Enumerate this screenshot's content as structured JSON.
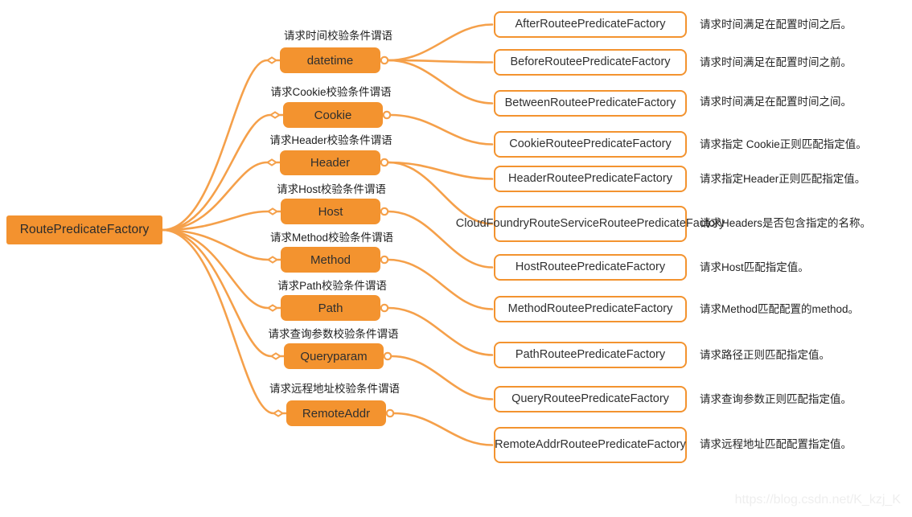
{
  "diagram": {
    "title": "RoutePredicateFactory",
    "colors": {
      "node_fill": "#f3932f",
      "edge": "#f5a04a",
      "leaf_border": "#f3932f",
      "leaf_fill": "#ffffff",
      "text": "#2b2b2b",
      "watermark": "#eeeeee"
    }
  },
  "root": {
    "label": "RoutePredicateFactory"
  },
  "branches": [
    {
      "id": "datetime",
      "name": "datetime",
      "caption": "请求时间校验条件谓语",
      "leaves": [
        {
          "name": "AfterRouteePredicateFactory",
          "desc": "请求时间满足在配置时间之后。"
        },
        {
          "name": "BeforeRouteePredicateFactory",
          "desc": "请求时间满足在配置时间之前。"
        },
        {
          "name": "BetweenRouteePredicateFactory",
          "desc": "请求时间满足在配置时间之间。"
        }
      ]
    },
    {
      "id": "cookie",
      "name": "Cookie",
      "caption": "请求Cookie校验条件谓语",
      "leaves": [
        {
          "name": "CookieRouteePredicateFactory",
          "desc": "请求指定 Cookie正则匹配指定值。"
        }
      ]
    },
    {
      "id": "header",
      "name": "Header",
      "caption": "请求Header校验条件谓语",
      "leaves": [
        {
          "name": "HeaderRouteePredicateFactory",
          "desc": "请求指定Header正则匹配指定值。"
        },
        {
          "name": "CloudFoundryRouteServiceRouteePredicateFactory",
          "desc": "请求Headers是否包含指定的名称。"
        }
      ]
    },
    {
      "id": "host",
      "name": "Host",
      "caption": "请求Host校验条件谓语",
      "leaves": [
        {
          "name": "HostRouteePredicateFactory",
          "desc": "请求Host匹配指定值。"
        }
      ]
    },
    {
      "id": "method",
      "name": "Method",
      "caption": "请求Method校验条件谓语",
      "leaves": [
        {
          "name": "MethodRouteePredicateFactory",
          "desc": "请求Method匹配配置的method。"
        }
      ]
    },
    {
      "id": "path",
      "name": "Path",
      "caption": "请求Path校验条件谓语",
      "leaves": [
        {
          "name": "PathRouteePredicateFactory",
          "desc": "请求路径正则匹配指定值。"
        }
      ]
    },
    {
      "id": "queryparam",
      "name": "Queryparam",
      "caption": "请求查询参数校验条件谓语",
      "leaves": [
        {
          "name": "QueryRouteePredicateFactory",
          "desc": "请求查询参数正则匹配指定值。"
        }
      ]
    },
    {
      "id": "remoteaddr",
      "name": "RemoteAddr",
      "caption": "请求远程地址校验条件谓语",
      "leaves": [
        {
          "name": "RemoteAddrRouteePredicateFactory",
          "desc": "请求远程地址匹配配置指定值。"
        }
      ]
    }
  ],
  "watermark": {
    "text": "https://blog.csdn.net/K_kzj_K"
  }
}
